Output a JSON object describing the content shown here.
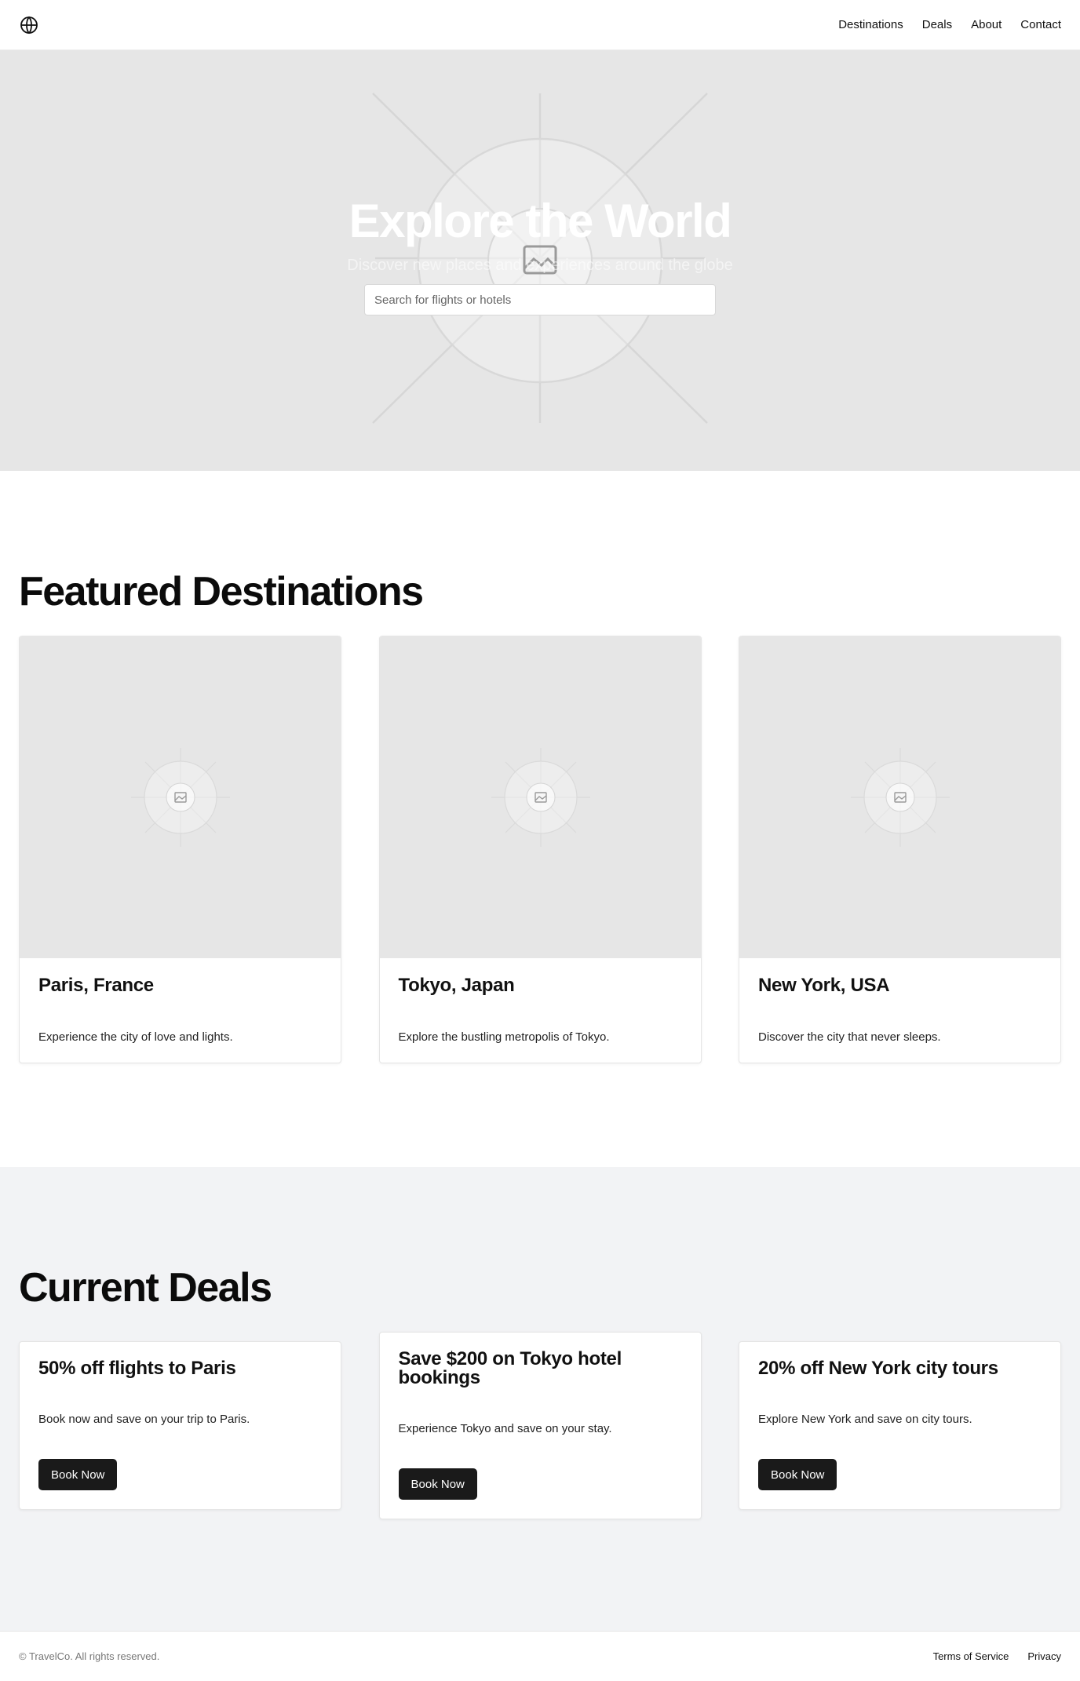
{
  "nav": {
    "logo_icon": "globe-icon",
    "links": [
      "Destinations",
      "Deals",
      "About",
      "Contact"
    ]
  },
  "hero": {
    "title": "Explore the World",
    "subtitle": "Discover new places and experiences around the globe",
    "search_placeholder": "Search for flights or hotels",
    "image_icon": "image-placeholder-icon"
  },
  "featured": {
    "title": "Featured Destinations",
    "cards": [
      {
        "title": "Paris, France",
        "text": "Experience the city of love and lights."
      },
      {
        "title": "Tokyo, Japan",
        "text": "Explore the bustling metropolis of Tokyo."
      },
      {
        "title": "New York, USA",
        "text": "Discover the city that never sleeps."
      }
    ]
  },
  "deals": {
    "title": "Current Deals",
    "cards": [
      {
        "title": "50% off flights to Paris",
        "text": "Book now and save on your trip to Paris.",
        "button": "Book Now"
      },
      {
        "title": "Save $200 on Tokyo hotel bookings",
        "text": "Experience Tokyo and save on your stay.",
        "button": "Book Now"
      },
      {
        "title": "20% off New York city tours",
        "text": "Explore New York and save on city tours.",
        "button": "Book Now"
      }
    ]
  },
  "footer": {
    "copyright": "© TravelCo. All rights reserved.",
    "links": [
      "Terms of Service",
      "Privacy"
    ]
  },
  "colors": {
    "button_bg": "#1a1a1a",
    "placeholder_bg": "#e6e6e6",
    "deals_bg": "#f2f3f5"
  }
}
